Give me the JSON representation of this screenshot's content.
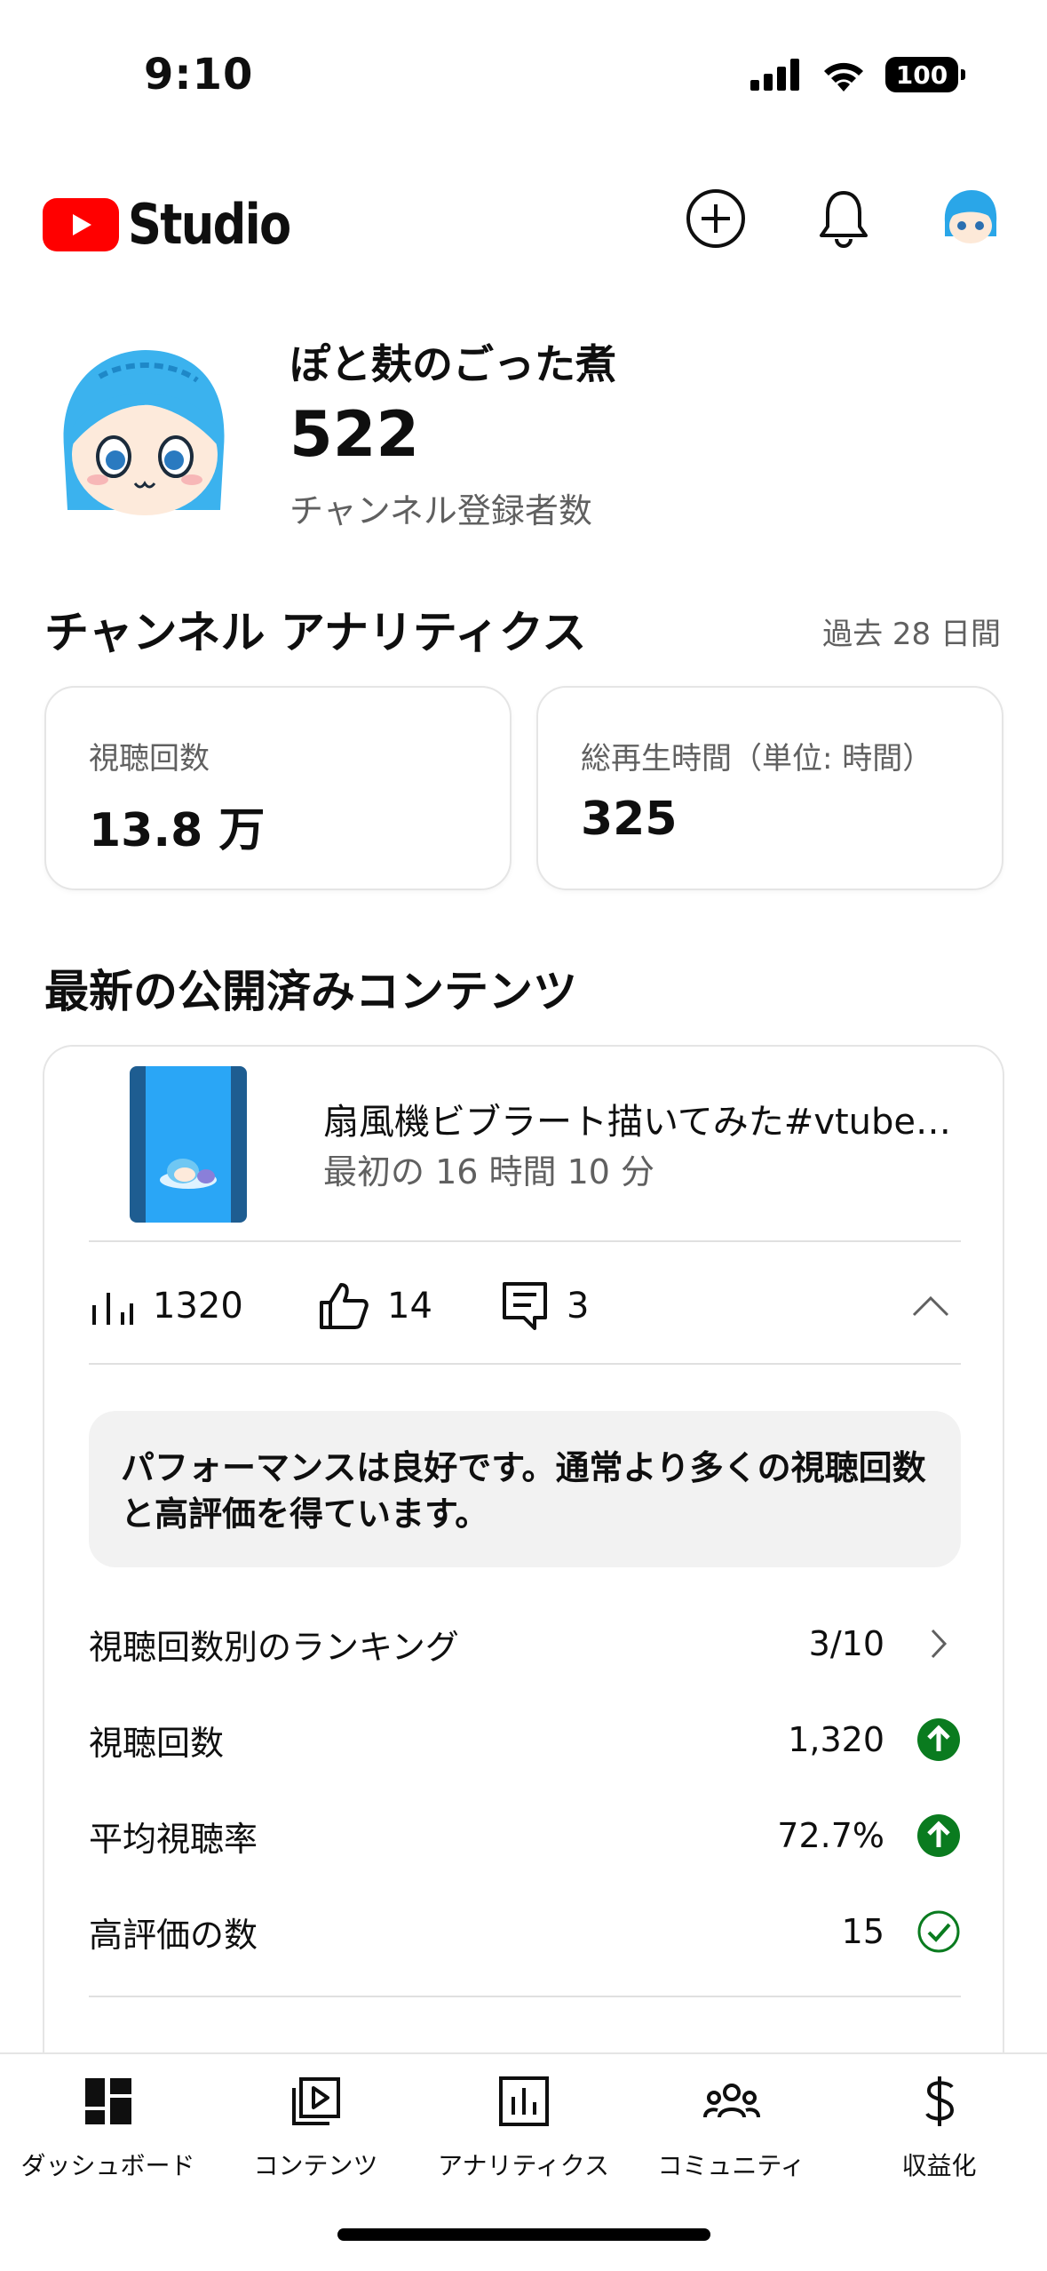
{
  "status_bar": {
    "time": "9:10",
    "battery": "100"
  },
  "header": {
    "logo_text": "Studio"
  },
  "channel": {
    "name": "ぽと麸のごった煮",
    "subscribers": "522",
    "subscribers_label": "チャンネル登録者数"
  },
  "analytics": {
    "title": "チャンネル アナリティクス",
    "period": "過去 28 日間",
    "cards": [
      {
        "label": "視聴回数",
        "value": "13.8 万"
      },
      {
        "label": "総再生時間（単位: 時間）",
        "value": "325"
      }
    ]
  },
  "latest": {
    "title": "最新の公開済みコンテンツ",
    "video_title": "扇風機ビブラート描いてみた#vtuber…",
    "video_subtitle": "最初の 16 時間 10 分",
    "metrics": {
      "views": "1320",
      "likes": "14",
      "comments": "3"
    },
    "insight": "パフォーマンスは良好です。通常より多くの視聴回数と高評価を得ています。",
    "rows": [
      {
        "label": "視聴回数別のランキング",
        "value": "3/10"
      },
      {
        "label": "視聴回数",
        "value": "1,320"
      },
      {
        "label": "平均視聴率",
        "value": "72.7%"
      },
      {
        "label": "高評価の数",
        "value": "15"
      }
    ]
  },
  "nav": [
    {
      "label": "ダッシュボード",
      "icon": "dashboard-icon"
    },
    {
      "label": "コンテンツ",
      "icon": "content-icon"
    },
    {
      "label": "アナリティクス",
      "icon": "analytics-icon"
    },
    {
      "label": "コミュニティ",
      "icon": "community-icon"
    },
    {
      "label": "収益化",
      "icon": "dollar-icon"
    }
  ],
  "colors": {
    "brand_red": "#ff0000",
    "success_green": "#0a7b1f"
  }
}
